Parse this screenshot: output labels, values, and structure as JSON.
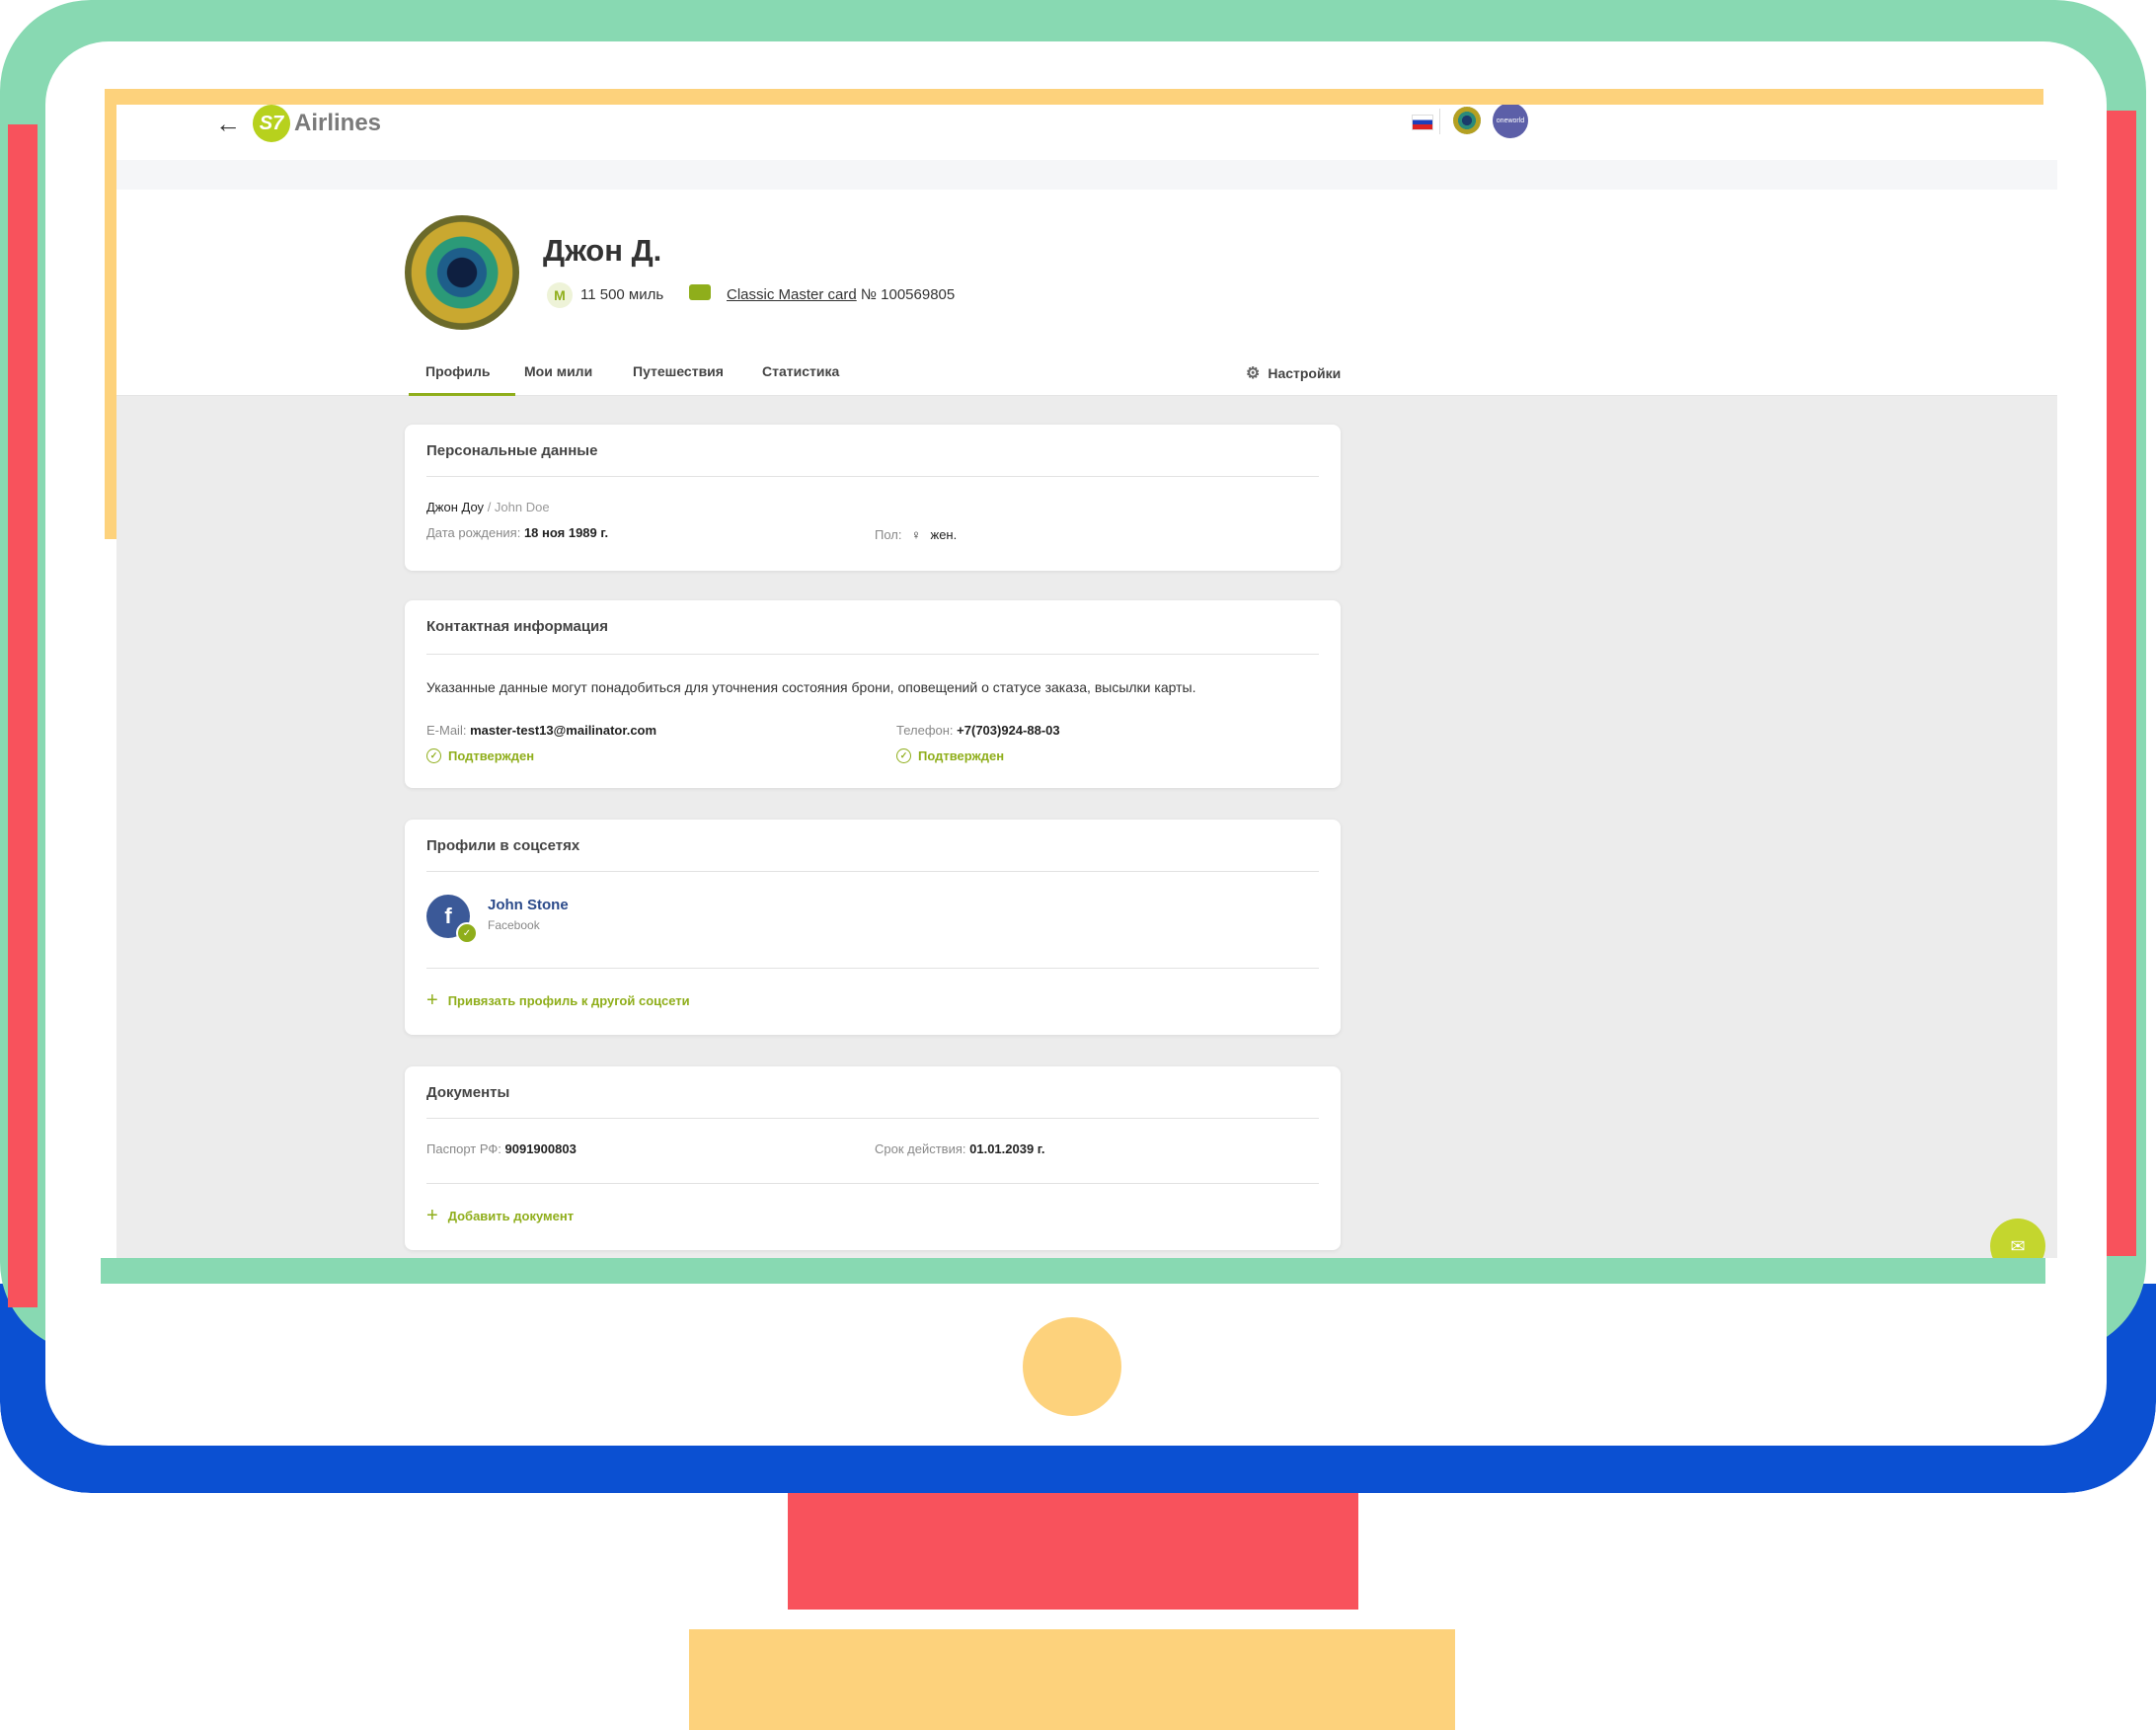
{
  "header": {
    "back_icon": "arrow-left-icon",
    "logo_mark": "S7",
    "logo_text": "Airlines",
    "oneworld_label": "oneworld"
  },
  "profile": {
    "name": "Джон Д.",
    "miles_symbol": "M",
    "miles": "11 500 миль",
    "card_name": "Classic Master card",
    "card_number": "№ 100569805"
  },
  "tabs": [
    {
      "label": "Профиль",
      "active": true
    },
    {
      "label": "Мои мили",
      "active": false
    },
    {
      "label": "Путешествия",
      "active": false
    },
    {
      "label": "Статистика",
      "active": false
    }
  ],
  "settings_label": "Настройки",
  "personal": {
    "title": "Персональные данные",
    "name_ru": "Джон Доу",
    "name_en": "/ John Doe",
    "dob_label": "Дата рождения:",
    "dob_value": "18 ноя 1989 г.",
    "gender_label": "Пол:",
    "gender_value": "жен."
  },
  "contact": {
    "title": "Контактная информация",
    "description": "Указанные данные могут понадобиться для уточнения состояния брони, оповещений о статусе заказа, высылки карты.",
    "email_label": "E-Mail:",
    "email_value": "master-test13@mailinator.com",
    "email_status": "Подтвержден",
    "phone_label": "Телефон:",
    "phone_value": "+7(703)924-88-03",
    "phone_status": "Подтвержден"
  },
  "social": {
    "title": "Профили в соцсетях",
    "profile_name": "John Stone",
    "network": "Facebook",
    "link_label": "Привязать профиль к другой соцсети"
  },
  "documents": {
    "title": "Документы",
    "passport_label": "Паспорт РФ:",
    "passport_value": "9091900803",
    "expiry_label": "Срок действия:",
    "expiry_value": "01.01.2039 г.",
    "add_label": "Добавить документ"
  },
  "colors": {
    "brand_green": "#8fae1b",
    "frame_teal": "#88d9b2",
    "frame_blue": "#0b50d2",
    "frame_red": "#f8525c",
    "frame_yellow": "#fdd27c"
  }
}
